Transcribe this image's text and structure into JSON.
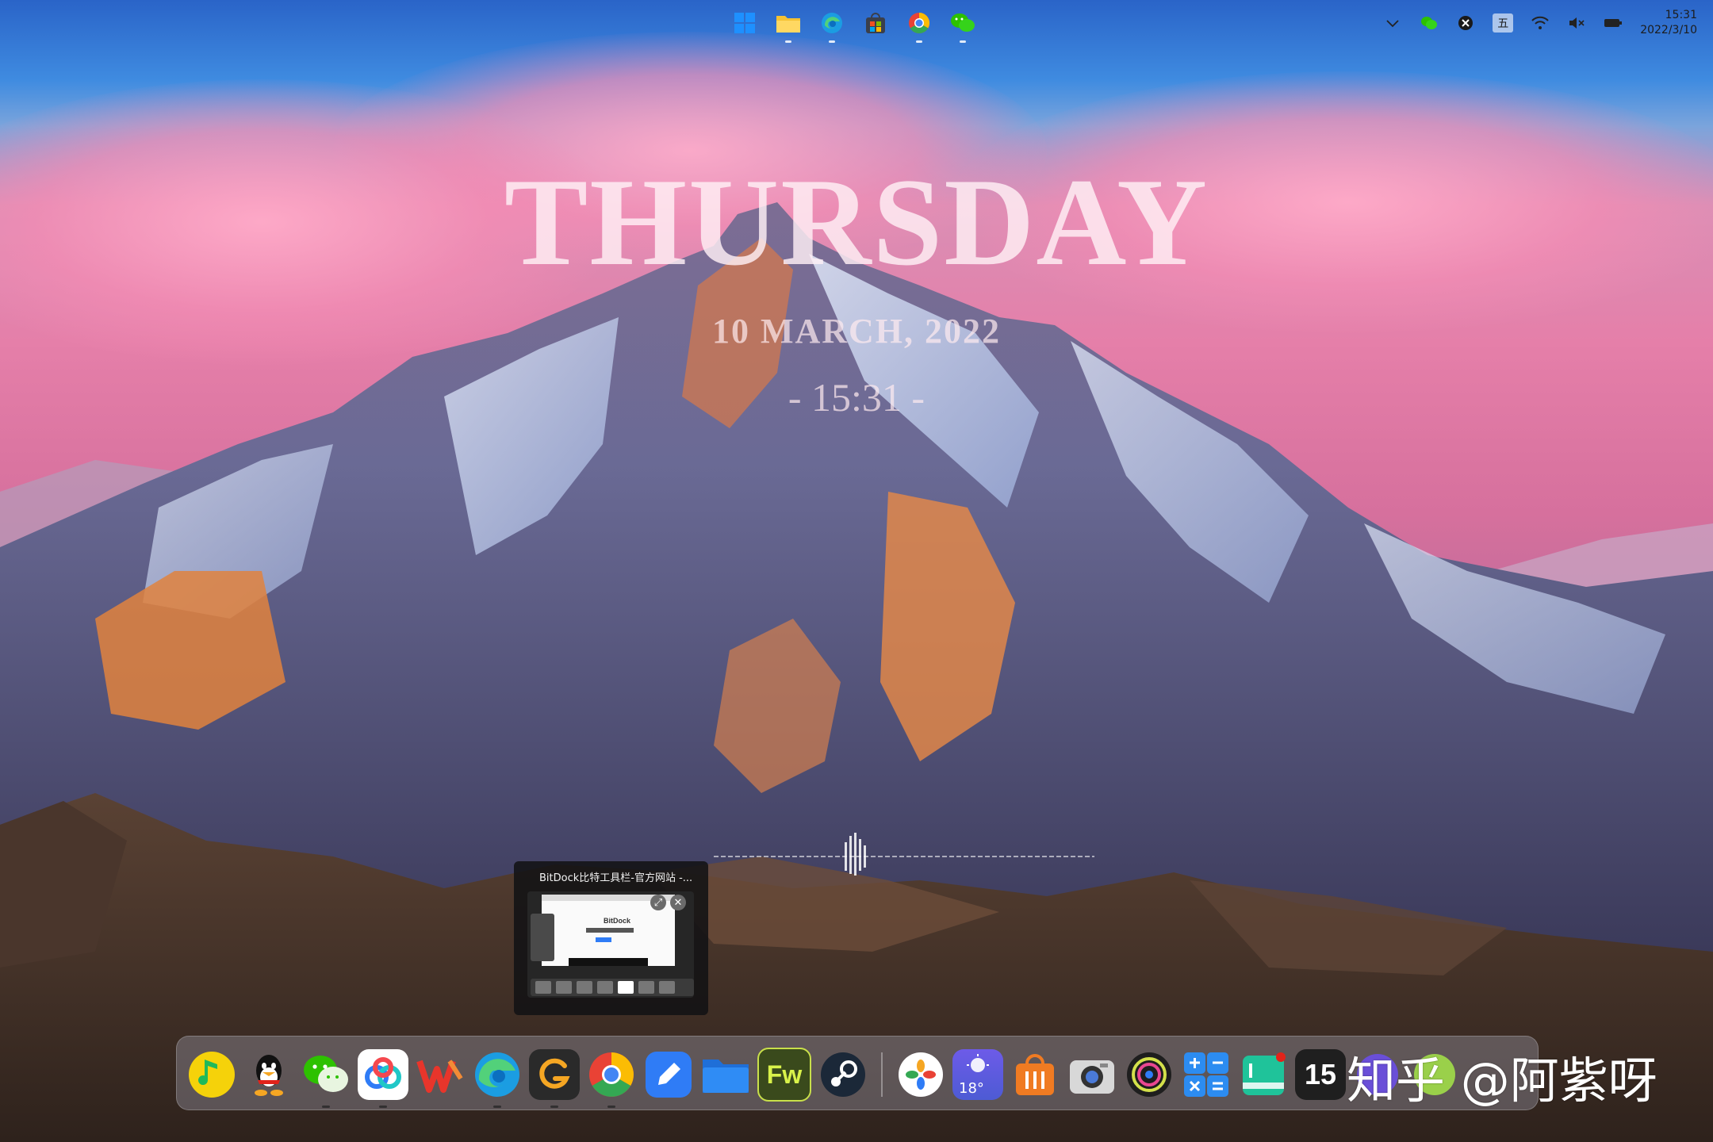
{
  "taskbar_top": {
    "apps": [
      {
        "name": "windows-start-icon"
      },
      {
        "name": "file-explorer-icon"
      },
      {
        "name": "edge-icon"
      },
      {
        "name": "store-icon"
      },
      {
        "name": "chrome-icon"
      },
      {
        "name": "wechat-icon"
      }
    ],
    "tray": {
      "ime_label": "五",
      "time": "15:31",
      "date": "2022/3/10"
    }
  },
  "date_widget": {
    "weekday": "THURSDAY",
    "date": "10 MARCH, 2022",
    "time": "- 15:31 -"
  },
  "window_preview": {
    "title": "BitDock比特工具栏-官方网站 -...",
    "page_brand": "BitDock"
  },
  "dock": {
    "items": [
      {
        "name": "qq-music-icon",
        "color": "#f5d20a"
      },
      {
        "name": "qq-icon",
        "color": "#ffffff"
      },
      {
        "name": "wechat-icon",
        "color": "#2dc100"
      },
      {
        "name": "baidu-netdisk-icon",
        "color": "#ffffff"
      },
      {
        "name": "wps-office-icon",
        "color": "#e8352b"
      },
      {
        "name": "edge-icon",
        "color": "#1b9de2"
      },
      {
        "name": "gaoding-icon",
        "color": "#2a2a2a"
      },
      {
        "name": "chrome-icon",
        "color": "#e94235"
      },
      {
        "name": "notes-icon",
        "color": "#2f7cf6"
      },
      {
        "name": "folder-icon",
        "color": "#2f8cf5"
      },
      {
        "name": "fireworks-icon",
        "color": "#3a4a1c",
        "label": "Fw"
      },
      {
        "name": "steam-icon",
        "color": "#1b2838"
      },
      {
        "name": "photos-icon",
        "color": "#ffffff"
      },
      {
        "name": "weather-icon",
        "color": "#5a55e0",
        "label": "18°"
      },
      {
        "name": "store-bag-icon",
        "color": "#f07b22"
      },
      {
        "name": "camera-icon",
        "color": "#d8d8d8"
      },
      {
        "name": "music-player-icon",
        "color": "#1e1e1e"
      },
      {
        "name": "calculator-icon",
        "color": "#2c8cf1"
      },
      {
        "name": "calendar-icon",
        "color": "#1fc39a"
      },
      {
        "name": "clock-widget-icon",
        "color": "#1f1f1f",
        "label": "15"
      }
    ]
  },
  "watermark": "知乎 @阿紫呀"
}
